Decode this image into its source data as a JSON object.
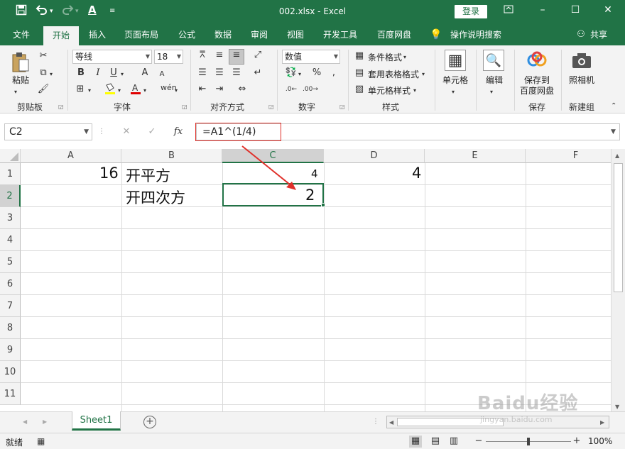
{
  "titlebar": {
    "title": "002.xlsx  -  Excel",
    "login": "登录",
    "save_icon": "save-icon",
    "undo_icon": "undo-icon",
    "redo_icon": "redo-icon",
    "font_color_icon": "font-color-icon"
  },
  "tabs": [
    "文件",
    "开始",
    "插入",
    "页面布局",
    "公式",
    "数据",
    "审阅",
    "视图",
    "开发工具",
    "百度网盘"
  ],
  "active_tab": "开始",
  "tell_me": "操作说明搜索",
  "share": "共享",
  "ribbon": {
    "clipboard": {
      "paste": "粘贴",
      "label": "剪贴板"
    },
    "font": {
      "name": "等线",
      "size": "18",
      "bold": "B",
      "italic": "I",
      "underline": "U",
      "grow": "A",
      "shrink": "A",
      "label": "字体"
    },
    "alignment": {
      "label": "对齐方式"
    },
    "number": {
      "format": "数值",
      "label": "数字"
    },
    "styles": {
      "conditional": "条件格式",
      "table": "套用表格格式",
      "cell_styles": "单元格样式",
      "label": "样式"
    },
    "cells": {
      "label": "单元格"
    },
    "editing": {
      "label": "编辑"
    },
    "save": {
      "button": "保存到\n百度网盘",
      "line1": "保存到",
      "line2": "百度网盘",
      "label": "保存"
    },
    "new_group": {
      "button": "照相机",
      "label": "新建组"
    }
  },
  "formula_bar": {
    "name_box": "C2",
    "fx": "fx",
    "formula": "=A1^(1/4)"
  },
  "grid": {
    "columns": [
      "A",
      "B",
      "C",
      "D",
      "E",
      "F"
    ],
    "rows": [
      "1",
      "2",
      "3",
      "4",
      "5",
      "6",
      "7",
      "8",
      "9",
      "10",
      "11"
    ],
    "selected_cell": "C2",
    "cells": {
      "A1": "16",
      "B1": "开平方",
      "C1": "4",
      "D1": "4",
      "B2": "开四次方",
      "C2": "2"
    }
  },
  "sheets": [
    "Sheet1"
  ],
  "status": {
    "ready": "就绪",
    "zoom": "100%"
  },
  "watermark": {
    "brand": "Baidu经验",
    "url": "jingyan.baidu.com"
  },
  "colors": {
    "excel_green": "#217346",
    "annotation_red": "#e0302a"
  }
}
